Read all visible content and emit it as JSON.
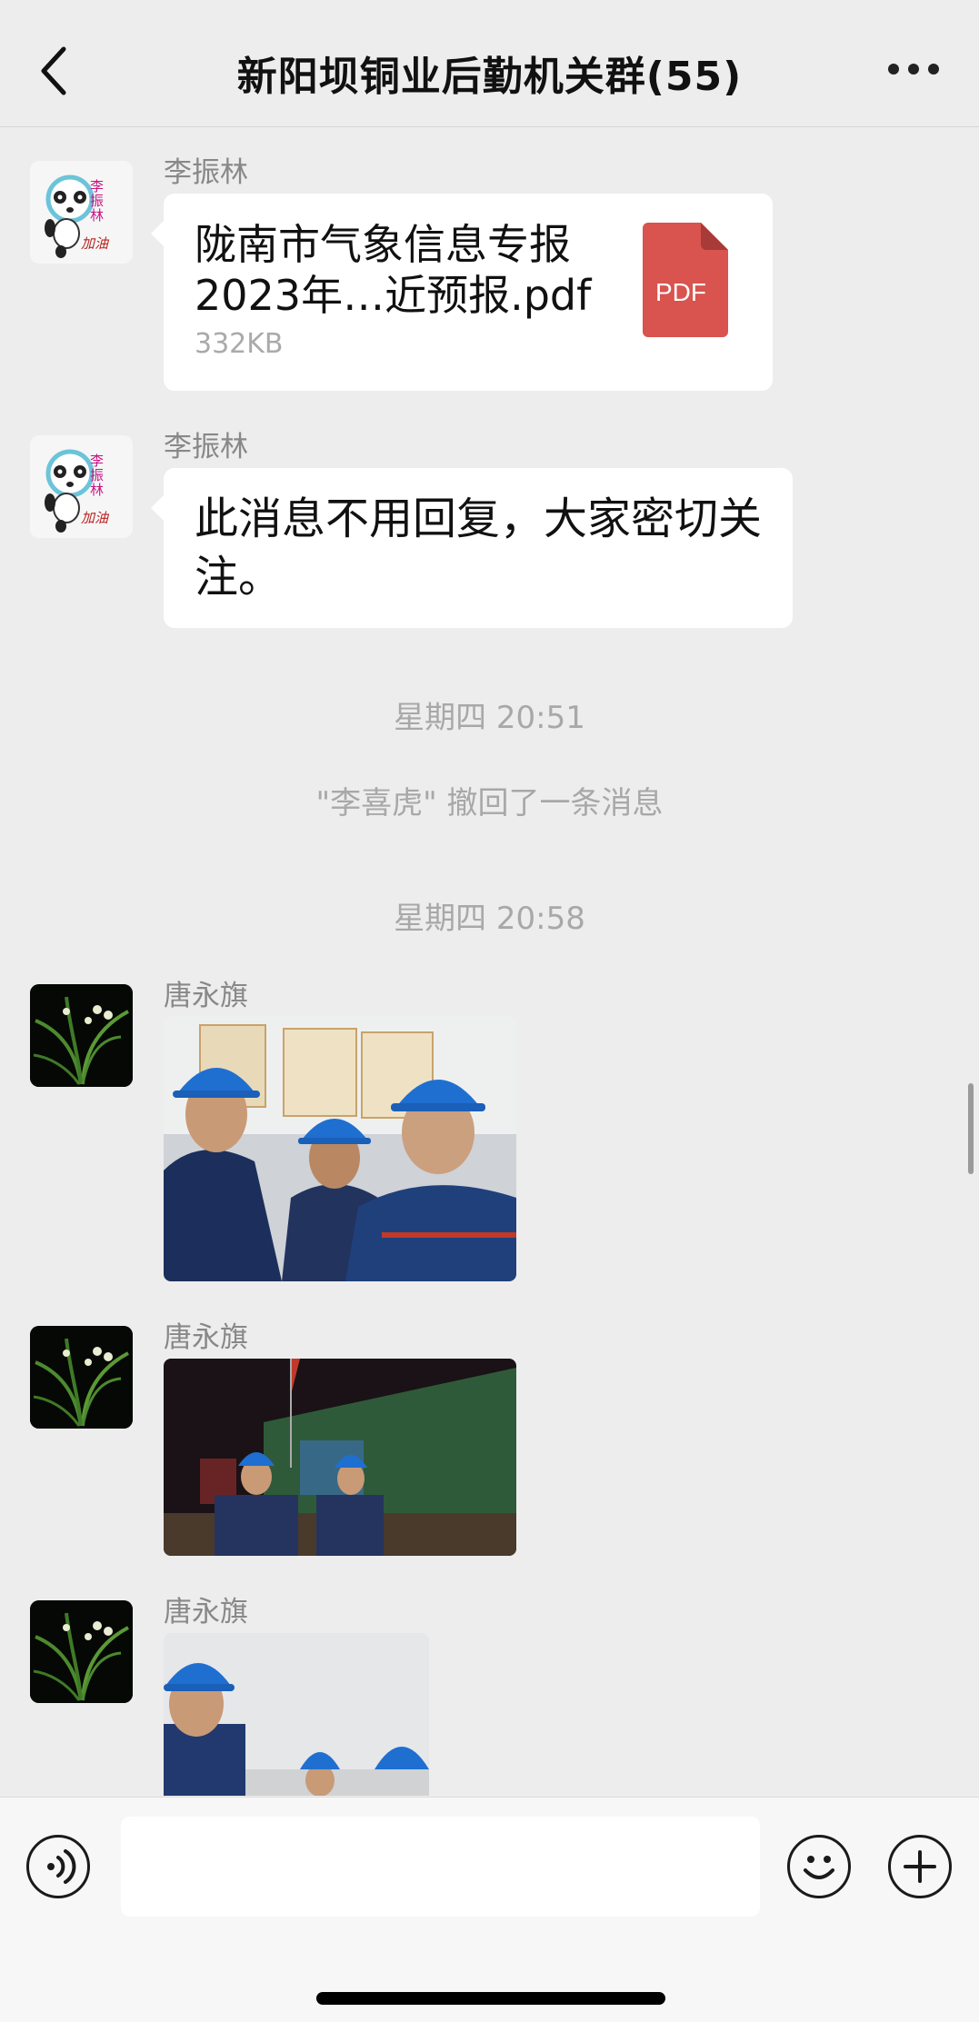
{
  "header": {
    "title": "新阳坝铜业后勤机关群(55)",
    "back_icon": "chevron-left-icon",
    "more_icon": "more-dots-icon"
  },
  "messages": [
    {
      "type": "file",
      "sender": "李振林",
      "file_name": "陇南市气象信息专报2023年…近预报.pdf",
      "file_size": "332KB",
      "file_badge": "PDF",
      "avatar_badge_top": "李振林",
      "avatar_badge_bottom": "加油"
    },
    {
      "type": "text",
      "sender": "李振林",
      "text": "此消息不用回复，大家密切关注。"
    },
    {
      "type": "system",
      "timestamp": "星期四 20:51",
      "notice": "\"李喜虎\" 撤回了一条消息"
    },
    {
      "type": "system",
      "timestamp": "星期四 20:58"
    },
    {
      "type": "image",
      "sender": "唐永旗"
    },
    {
      "type": "image",
      "sender": "唐永旗"
    },
    {
      "type": "image",
      "sender": "唐永旗"
    }
  ],
  "input_bar": {
    "voice_icon": "voice-icon",
    "text_value": "",
    "emoji_icon": "emoji-icon",
    "add_icon": "plus-icon"
  },
  "colors": {
    "background": "#ededed",
    "bubble": "#ffffff",
    "pdf_red": "#d9534f",
    "helmet_blue": "#1f6fd1"
  }
}
